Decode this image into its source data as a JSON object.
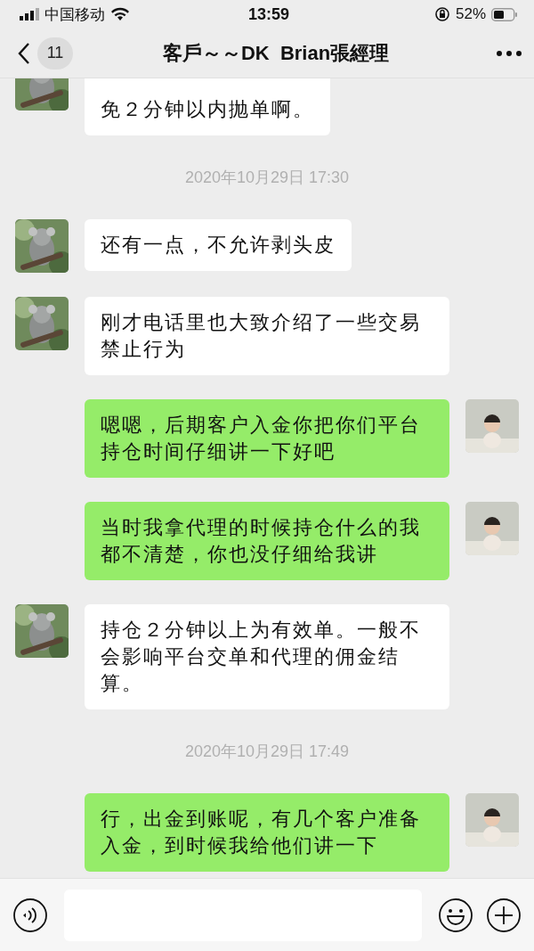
{
  "status_bar": {
    "carrier": "中国移动",
    "time": "13:59",
    "battery": "52%"
  },
  "header": {
    "unread": "11",
    "title": "客戶～～DK  Brian張經理"
  },
  "messages": [
    {
      "kind": "received",
      "text": "免２分钟以内抛单啊。"
    },
    {
      "kind": "time",
      "text": "2020年10月29日 17:30"
    },
    {
      "kind": "received",
      "text": "还有一点，不允许剥头皮"
    },
    {
      "kind": "received",
      "text": "刚才电话里也大致介绍了一些交易禁止行为"
    },
    {
      "kind": "sent",
      "text": "嗯嗯，后期客户入金你把你们平台持仓时间仔细讲一下好吧"
    },
    {
      "kind": "sent",
      "text": "当时我拿代理的时候持仓什么的我都不清楚，你也没仔细给我讲"
    },
    {
      "kind": "received",
      "text": "持仓２分钟以上为有效单。一般不会影响平台交单和代理的佣金结算。"
    },
    {
      "kind": "time",
      "text": "2020年10月29日 17:49"
    },
    {
      "kind": "sent",
      "text": "行，出金到账呢，有几个客户准备入金，到时候我给他们讲一下"
    }
  ]
}
